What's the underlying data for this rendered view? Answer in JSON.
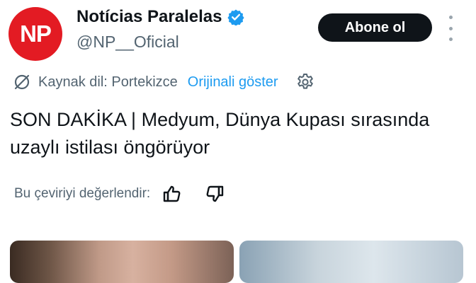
{
  "author": {
    "avatar_text": "NP",
    "display_name": "Notícias Paralelas",
    "handle": "@NP__Oficial",
    "verified": true
  },
  "follow_button": {
    "label": "Abone ol"
  },
  "translation": {
    "source_label": "Kaynak dil: Portekizce",
    "show_original_label": "Orijinali göster"
  },
  "tweet": {
    "text": "SON DAKİKA | Medyum, Dünya Kupası sırasında uzaylı istilası öngörüyor"
  },
  "rating": {
    "label": "Bu çeviriyi değerlendir:"
  },
  "icons": [
    "verified-badge-icon",
    "more-dots-icon",
    "no-translate-icon",
    "gear-icon",
    "thumbs-up-icon",
    "thumbs-down-icon"
  ],
  "colors": {
    "avatar_bg": "#e31b23",
    "verified": "#1d9bf0",
    "link": "#1d9bf0",
    "follow_bg": "#0f1419",
    "secondary_text": "#536471"
  }
}
